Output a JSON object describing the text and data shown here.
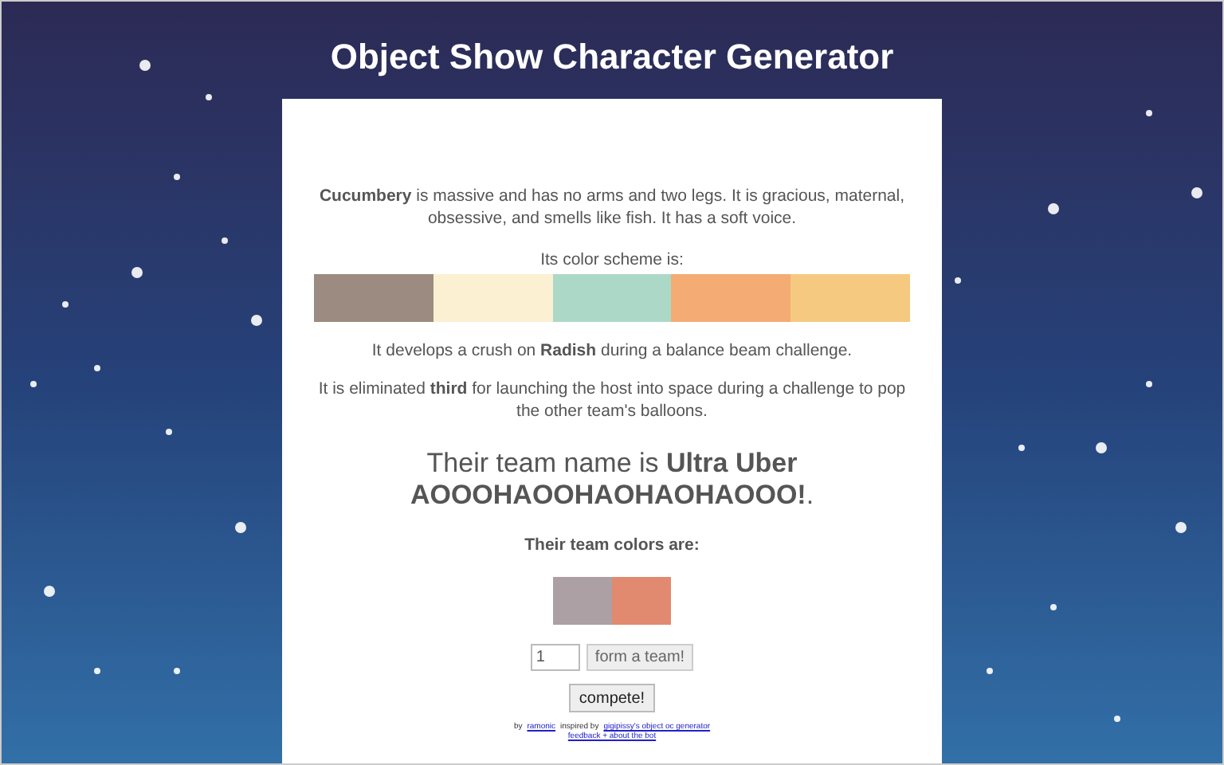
{
  "title": "Object Show Character Generator",
  "description": "**Cucumbery** is massive and has no arms and two legs. It is gracious, maternal, obsessive, and smells like fish. It has a soft voice.",
  "scheme_label": "Its color scheme is:",
  "color_scheme": [
    {
      "color": "#9c8b80"
    },
    {
      "color": "#fcf0d2"
    },
    {
      "color": "#acd8c8"
    },
    {
      "color": "#f5ab74"
    },
    {
      "color": "#f5ca80"
    }
  ],
  "crush": "It develops a crush on **Radish** during a balance beam challenge.",
  "elimination": "It is eliminated **third** for launching the host into space during a challenge to pop the other team's balloons.",
  "team_name": "Their team name is **Ultra Uber AOOOHAOOHAOHAOHAOOO!**.",
  "team_colors_label": "Their team colors are:",
  "team_colors": [
    {
      "color": "#aca0a4"
    },
    {
      "color": "#e28a70"
    }
  ],
  "team_count": {
    "value": "1"
  },
  "form_button": "form a team!",
  "compete_button": "compete!",
  "footer": {
    "by": "by",
    "author": "ramonic",
    "inspired": "inspired by",
    "source": "gigipissy's object oc generator",
    "feedback": "feedback + about the bot"
  }
}
